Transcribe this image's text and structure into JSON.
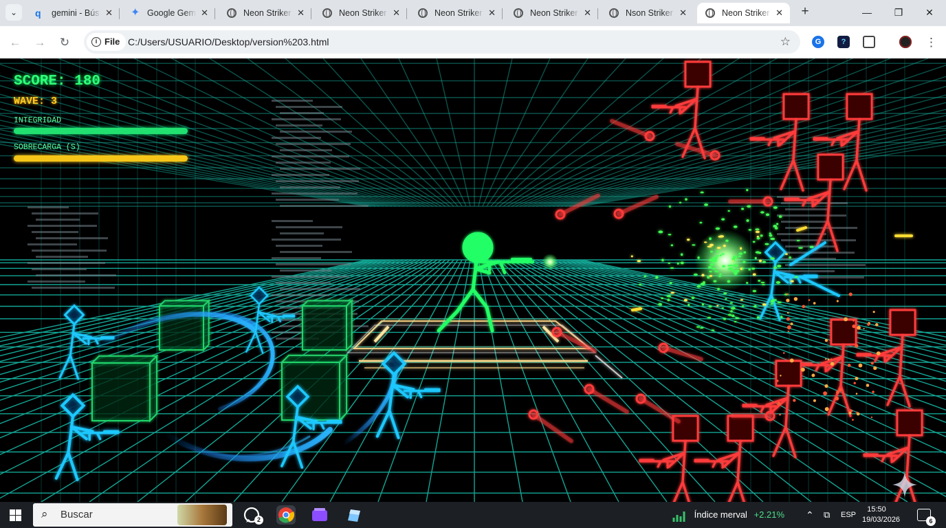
{
  "browser": {
    "tabs": [
      {
        "label": "gemini - Bús",
        "icon": "search-icon"
      },
      {
        "label": "Google Gem",
        "icon": "gemini-icon"
      },
      {
        "label": "Neon Striker",
        "icon": "globe-icon"
      },
      {
        "label": "Neon Striker",
        "icon": "globe-icon"
      },
      {
        "label": "Neon Striker",
        "icon": "globe-icon"
      },
      {
        "label": "Neon Striker",
        "icon": "globe-icon"
      },
      {
        "label": "Nson Striker",
        "icon": "globe-icon"
      },
      {
        "label": "Neon Striker",
        "icon": "globe-icon",
        "active": true
      }
    ],
    "tab_close": "✕",
    "new_tab": "+",
    "window": {
      "minimize": "—",
      "restore": "❐",
      "close": "✕"
    },
    "scheme_chip": "File",
    "url": "C:/Users/USUARIO/Desktop/version%203.html",
    "ext_g": "G",
    "ext_q": "?"
  },
  "hud": {
    "score": "SCORE: 180",
    "wave": "WAVE: 3",
    "health_label": "INTEGRIDAD",
    "health_level": 1.0,
    "overcharge_label": "SOBRECARGA (S)",
    "overcharge_level": 1.0
  },
  "colors": {
    "grid": "#17c4b0",
    "player": "#22ff66",
    "allies": "#1fc8ff",
    "enemies": "#ff3b3b",
    "crates": "#22d46a",
    "platform": "#ffd98a"
  },
  "taskbar": {
    "search_placeholder": "Buscar",
    "whatsapp_badge": "2",
    "market_label": "Índice merval",
    "market_change": "+2.21%",
    "language": "ESP",
    "time": "15:50",
    "date": "19/03/2026",
    "notifications": "6"
  }
}
